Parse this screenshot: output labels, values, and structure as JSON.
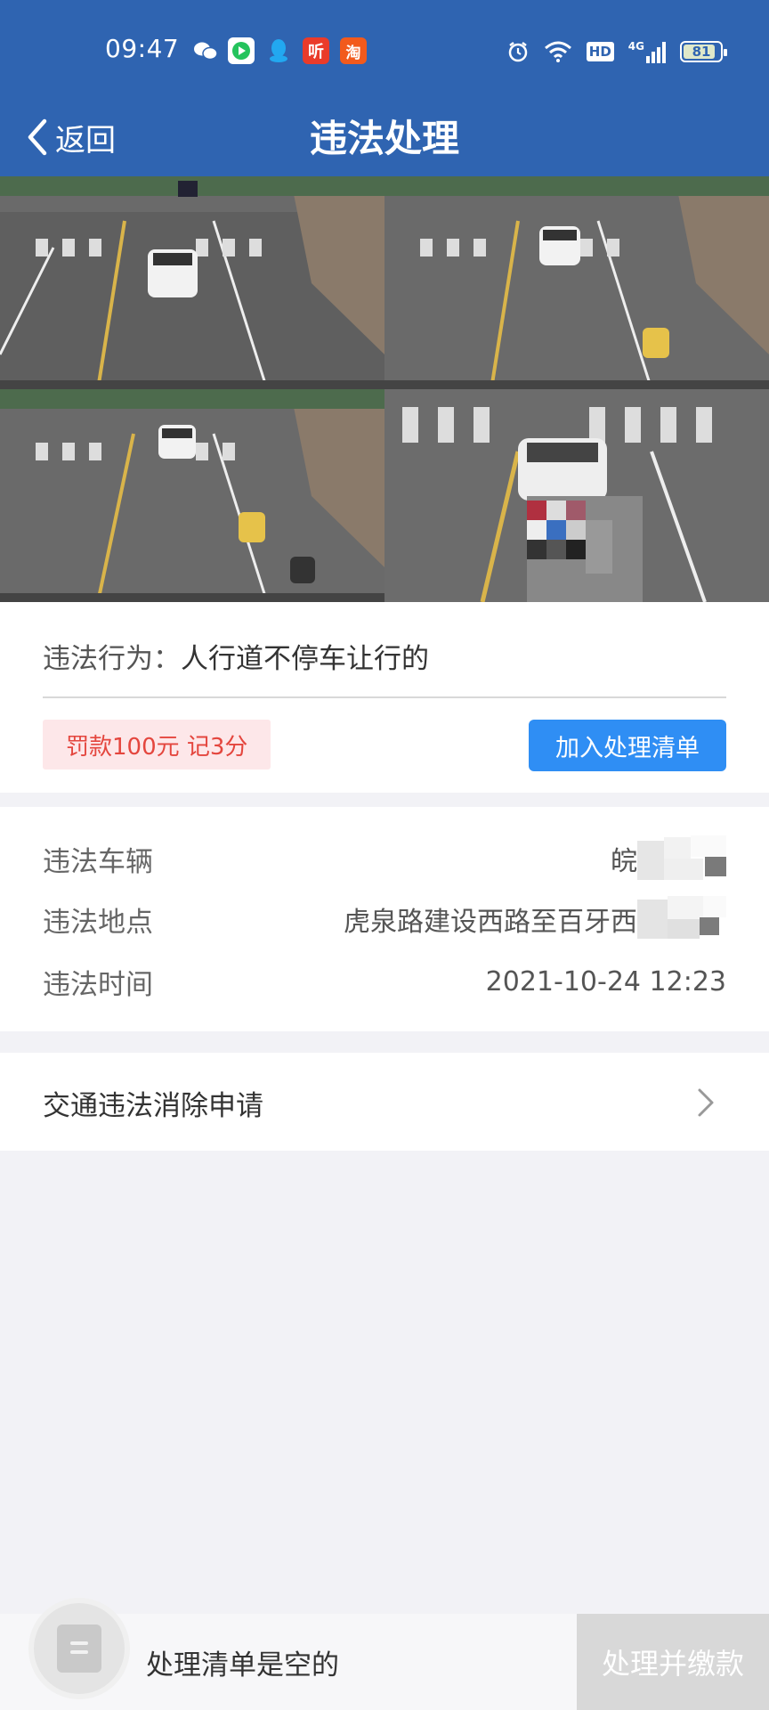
{
  "status_bar": {
    "time": "09:47",
    "app_icons": [
      "wechat-icon",
      "video-icon",
      "qq-icon",
      "listen-app-icon",
      "taobao-icon"
    ],
    "listen_icon_text": "听",
    "taobao_icon_text": "淘",
    "hd_label": "HD",
    "network_label": "4G",
    "battery_level": "81",
    "system_icons": [
      "alarm-icon",
      "wifi-icon",
      "hd-icon",
      "signal-icon",
      "battery-icon"
    ]
  },
  "nav": {
    "back_label": "返回",
    "title": "违法处理"
  },
  "photos": {
    "count": 4
  },
  "violation": {
    "behavior_label": "违法行为：",
    "behavior_value": "人行道不停车让行的",
    "fine_text": "罚款100元 记3分",
    "add_button": "加入处理清单"
  },
  "details": {
    "vehicle_label": "违法车辆",
    "vehicle_value": "皖",
    "location_label": "违法地点",
    "location_value": "虎泉路建设西路至百牙西",
    "time_label": "违法时间",
    "time_value": "2021-10-24 12:23"
  },
  "appeal": {
    "label": "交通违法消除申请"
  },
  "bottom": {
    "empty_text": "处理清单是空的",
    "pay_button": "处理并缴款"
  },
  "colors": {
    "header": "#2f64b1",
    "primary_button": "#2f8ef4",
    "fine_text": "#e4463e",
    "fine_bg": "#fde7e9",
    "disabled_button": "#d8d8d8"
  }
}
